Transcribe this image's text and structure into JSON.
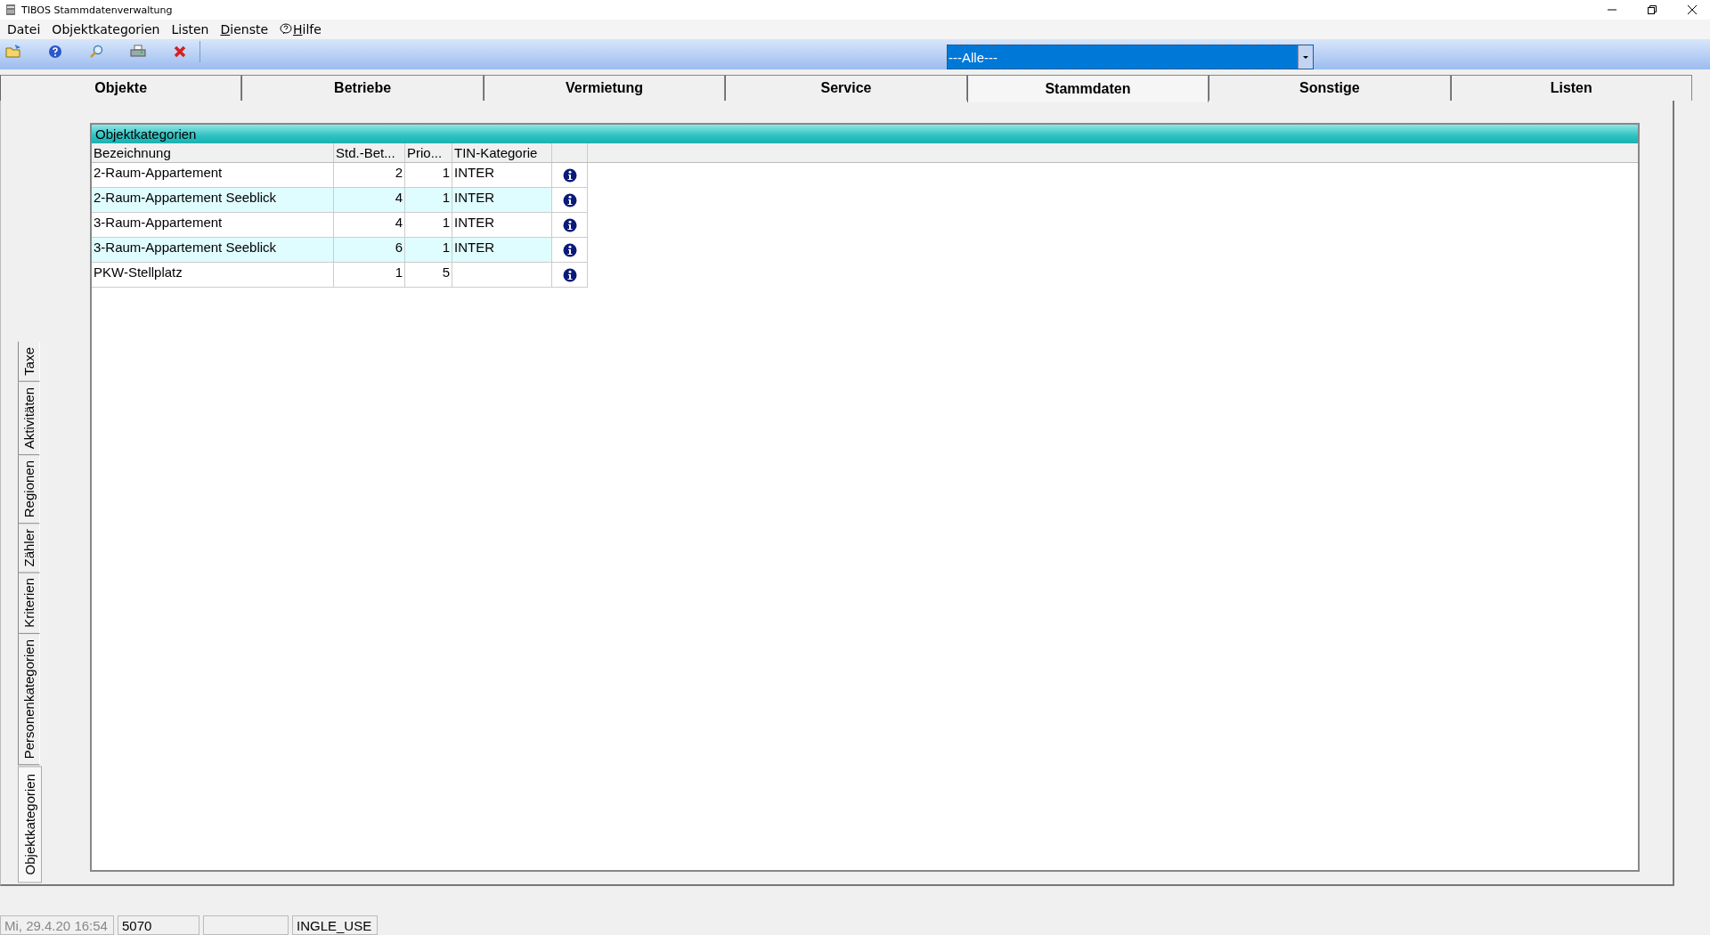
{
  "window": {
    "title": "TIBOS Stammdatenverwaltung"
  },
  "menu": [
    {
      "label": "Datei",
      "mnemonic": false
    },
    {
      "label": "Objektkategorien",
      "mnemonic": false
    },
    {
      "label": "Listen",
      "mnemonic": false
    },
    {
      "label": "Dienste",
      "mnemonic": true
    },
    {
      "label": "Hilfe",
      "mnemonic": true
    }
  ],
  "toolbar": {
    "filter": {
      "value": "---Alle---"
    }
  },
  "tabs": [
    {
      "label": "Objekte",
      "selected": false
    },
    {
      "label": "Betriebe",
      "selected": false
    },
    {
      "label": "Vermietung",
      "selected": false
    },
    {
      "label": "Service",
      "selected": false
    },
    {
      "label": "Stammdaten",
      "selected": true
    },
    {
      "label": "Sonstige",
      "selected": false
    },
    {
      "label": "Listen",
      "selected": false
    }
  ],
  "side_tabs": [
    {
      "label": "Objektkategorien",
      "selected": true
    },
    {
      "label": "Personenkategorien",
      "selected": false
    },
    {
      "label": "Kriterien",
      "selected": false
    },
    {
      "label": "Zähler",
      "selected": false
    },
    {
      "label": "Regionen",
      "selected": false
    },
    {
      "label": "Aktivitäten",
      "selected": false
    },
    {
      "label": "Taxe",
      "selected": false
    }
  ],
  "table": {
    "title": "Objektkategorien",
    "columns": [
      "Bezeichnung",
      "Std.-Bet...",
      "Prio...",
      "TIN-Kategorie"
    ],
    "rows": [
      {
        "cells": [
          "2-Raum-Appartement",
          "2",
          "1",
          "INTER"
        ]
      },
      {
        "cells": [
          "2-Raum-Appartement Seeblick",
          "4",
          "1",
          "INTER"
        ]
      },
      {
        "cells": [
          "3-Raum-Appartement",
          "4",
          "1",
          "INTER"
        ]
      },
      {
        "cells": [
          "3-Raum-Appartement Seeblick",
          "6",
          "1",
          "INTER"
        ]
      },
      {
        "cells": [
          "PKW-Stellplatz",
          "1",
          "5",
          null
        ]
      }
    ]
  },
  "status_bar": {
    "panel_1": "Mi, 29.4.20 16:54",
    "panel_2": "5070",
    "panel_4": "INGLE_USE"
  }
}
